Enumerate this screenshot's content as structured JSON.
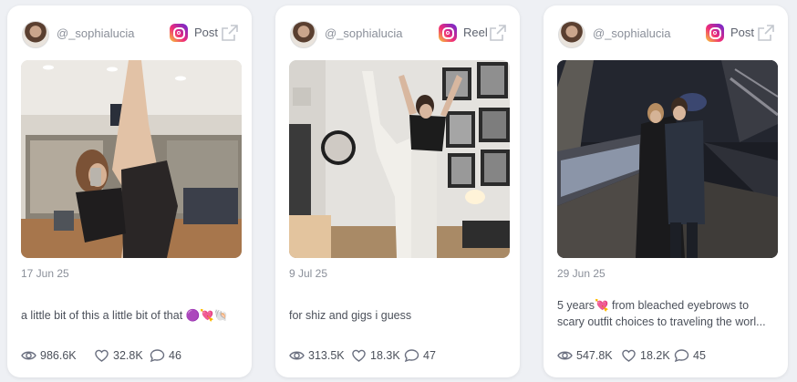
{
  "cards": [
    {
      "handle": "@_sophialucia",
      "post_type": "Post",
      "date": "17 Jun 25",
      "caption_lines": [
        "a little bit of this a little bit of that 🟣💘🐚"
      ],
      "stats": {
        "views": "986.6K",
        "likes": "32.8K",
        "comments": "46"
      }
    },
    {
      "handle": "@_sophialucia",
      "post_type": "Reel",
      "date": "9 Jul 25",
      "caption_lines": [
        "for shiz and gigs i guess"
      ],
      "stats": {
        "views": "313.5K",
        "likes": "18.3K",
        "comments": "47"
      }
    },
    {
      "handle": "@_sophialucia",
      "post_type": "Post",
      "date": "29 Jun 25",
      "caption_lines": [
        "5 years💘 from bleached eyebrows to",
        "scary outfit choices to traveling the worl..."
      ],
      "stats": {
        "views": "547.8K",
        "likes": "18.2K",
        "comments": "45"
      }
    }
  ],
  "icons": {
    "platform": "instagram-icon",
    "open": "external-link-icon",
    "views": "eye-icon",
    "likes": "heart-icon",
    "comments": "comment-icon"
  },
  "colors": {
    "page_bg": "#eef0f4",
    "card_bg": "#ffffff",
    "muted_text": "#8a8f99",
    "body_text": "#4b505a"
  }
}
